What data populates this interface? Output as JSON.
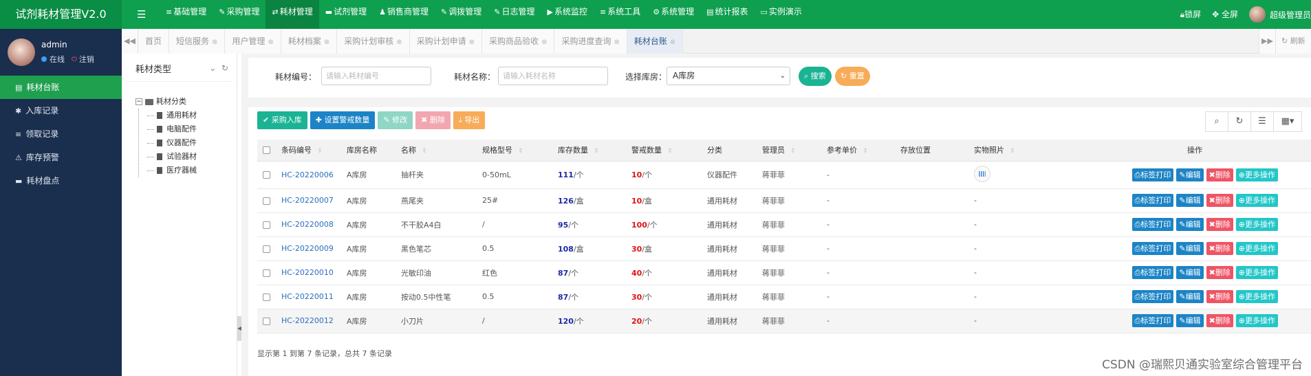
{
  "app": {
    "title": "试剂耗材管理V2.0",
    "menu_toggle_icon": "bars-icon"
  },
  "topnav": [
    {
      "icon": "≡",
      "label": "基础管理"
    },
    {
      "icon": "✎",
      "label": "采购管理"
    },
    {
      "icon": "⇄",
      "label": "耗材管理",
      "active": true
    },
    {
      "icon": "▬",
      "label": "试剂管理"
    },
    {
      "icon": "♟",
      "label": "销售商管理"
    },
    {
      "icon": "✎",
      "label": "调拨管理"
    },
    {
      "icon": "✎",
      "label": "日志管理"
    },
    {
      "icon": "▶",
      "label": "系统监控"
    },
    {
      "icon": "≡",
      "label": "系统工具"
    },
    {
      "icon": "⚙",
      "label": "系统管理"
    },
    {
      "icon": "▤",
      "label": "统计报表"
    },
    {
      "icon": "▭",
      "label": "实例演示"
    }
  ],
  "topright": {
    "lock": "锁屏",
    "fullscreen": "全屏",
    "user": "超级管理员"
  },
  "profile": {
    "name": "admin",
    "status": "在线",
    "logout": "注销"
  },
  "sidemenu": [
    {
      "icon": "▤",
      "label": "耗材台账",
      "active": true
    },
    {
      "icon": "✱",
      "label": "入库记录"
    },
    {
      "icon": "≡",
      "label": "领取记录"
    },
    {
      "icon": "⚠",
      "label": "库存预警"
    },
    {
      "icon": "▬",
      "label": "耗材盘点"
    }
  ],
  "tabs": [
    {
      "label": "首页",
      "closable": false
    },
    {
      "label": "短信服务",
      "closable": true
    },
    {
      "label": "用户管理",
      "closable": true
    },
    {
      "label": "耗材档案",
      "closable": true
    },
    {
      "label": "采购计划审核",
      "closable": true
    },
    {
      "label": "采购计划申请",
      "closable": true
    },
    {
      "label": "采购商品验收",
      "closable": true
    },
    {
      "label": "采购进度查询",
      "closable": true
    },
    {
      "label": "耗材台账",
      "closable": true,
      "active": true
    }
  ],
  "tab_refresh": "刷新",
  "tree": {
    "title": "耗材类型",
    "root": "耗材分类",
    "children": [
      "通用耗材",
      "电脑配件",
      "仪器配件",
      "试验器材",
      "医疗器械"
    ]
  },
  "search": {
    "code_label": "耗材编号：",
    "code_placeholder": "请输入耗材编号",
    "name_label": "耗材名称：",
    "name_placeholder": "请输入耗材名称",
    "warehouse_label": "选择库房：",
    "warehouse_value": "A库房",
    "search_btn": "搜索",
    "reset_btn": "重置"
  },
  "toolbar": {
    "purchase_in": "采购入库",
    "set_warning": "设置警戒数量",
    "edit": "修改",
    "delete": "删除",
    "export": "导出"
  },
  "table": {
    "headers": [
      "条码编号",
      "库房名称",
      "名称",
      "规格型号",
      "库存数量",
      "警戒数量",
      "分类",
      "管理员",
      "参考单价",
      "存放位置",
      "实物照片",
      "操作"
    ],
    "rows": [
      {
        "code": "HC-20220006",
        "warehouse": "A库房",
        "name": "抽杆夹",
        "spec": "0-50mL",
        "stock": "111",
        "stock_unit": "/个",
        "warn": "10",
        "warn_unit": "/个",
        "category": "仪器配件",
        "admin": "蒋菲菲",
        "price": "-",
        "location": "",
        "photo": true
      },
      {
        "code": "HC-20220007",
        "warehouse": "A库房",
        "name": "燕尾夹",
        "spec": "25#",
        "stock": "126",
        "stock_unit": "/盒",
        "warn": "10",
        "warn_unit": "/盒",
        "category": "通用耗材",
        "admin": "蒋菲菲",
        "price": "-",
        "location": "",
        "photo_text": "-"
      },
      {
        "code": "HC-20220008",
        "warehouse": "A库房",
        "name": "不干胶A4白",
        "spec": "/",
        "stock": "95",
        "stock_unit": "/个",
        "warn": "100",
        "warn_unit": "/个",
        "category": "通用耗材",
        "admin": "蒋菲菲",
        "price": "-",
        "location": "",
        "photo_text": "-"
      },
      {
        "code": "HC-20220009",
        "warehouse": "A库房",
        "name": "黑色笔芯",
        "spec": "0.5",
        "stock": "108",
        "stock_unit": "/盒",
        "warn": "30",
        "warn_unit": "/盒",
        "category": "通用耗材",
        "admin": "蒋菲菲",
        "price": "-",
        "location": "",
        "photo_text": "-"
      },
      {
        "code": "HC-20220010",
        "warehouse": "A库房",
        "name": "光敏印油",
        "spec": "红色",
        "stock": "87",
        "stock_unit": "/个",
        "warn": "40",
        "warn_unit": "/个",
        "category": "通用耗材",
        "admin": "蒋菲菲",
        "price": "-",
        "location": "",
        "photo_text": "-"
      },
      {
        "code": "HC-20220011",
        "warehouse": "A库房",
        "name": "按动0.5中性笔",
        "spec": "0.5",
        "stock": "87",
        "stock_unit": "/个",
        "warn": "30",
        "warn_unit": "/个",
        "category": "通用耗材",
        "admin": "蒋菲菲",
        "price": "-",
        "location": "",
        "photo_text": "-"
      },
      {
        "code": "HC-20220012",
        "warehouse": "A库房",
        "name": "小刀片",
        "spec": "/",
        "stock": "120",
        "stock_unit": "/个",
        "warn": "20",
        "warn_unit": "/个",
        "category": "通用耗材",
        "admin": "蒋菲菲",
        "price": "-",
        "location": "",
        "photo_text": "-"
      }
    ],
    "ops": {
      "print": "标签打印",
      "edit": "编辑",
      "delete": "删除",
      "more": "更多操作"
    }
  },
  "pager": "显示第 1 到第 7 条记录，总共 7 条记录",
  "watermark": "CSDN @瑞熙贝通实验室综合管理平台",
  "colors": {
    "topbar": "#0e9f4f",
    "sidebar": "#1a2e4e",
    "primary_green": "#1ab394",
    "blue": "#1c84c6",
    "red": "#ed5565",
    "orange": "#f8ac59",
    "cyan": "#23c6c8"
  }
}
